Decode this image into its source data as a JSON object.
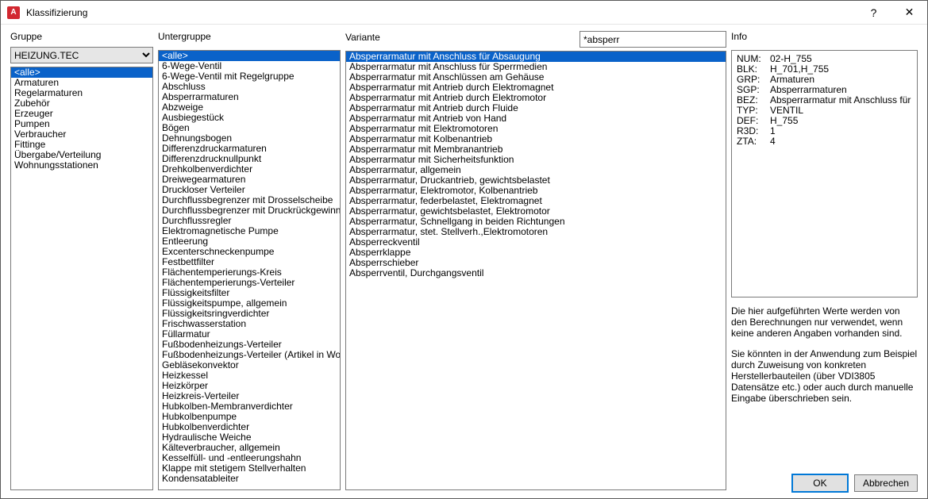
{
  "window": {
    "title": "Klassifizierung",
    "help_icon": "?",
    "close_icon": "✕"
  },
  "labels": {
    "gruppe": "Gruppe",
    "untergruppe": "Untergruppe",
    "variante": "Variante",
    "info": "Info"
  },
  "gruppe": {
    "selected_combo": "HEIZUNG.TEC",
    "items": [
      "<alle>",
      "Armaturen",
      "Regelarmaturen",
      "Zubehör",
      "Erzeuger",
      "Pumpen",
      "Verbraucher",
      "Fittinge",
      "Übergabe/Verteilung",
      "Wohnungsstationen"
    ],
    "selected_index": 0
  },
  "untergruppe": {
    "items": [
      "<alle>",
      "6-Wege-Ventil",
      "6-Wege-Ventil mit Regelgruppe",
      "Abschluss",
      "Absperrarmaturen",
      "Abzweige",
      "Ausbiegestück",
      "Bögen",
      "Dehnungsbogen",
      "Differenzdruckarmaturen",
      "Differenzdrucknullpunkt",
      "Drehkolbenverdichter",
      "Dreiwegearmaturen",
      "Druckloser Verteiler",
      "Durchflussbegrenzer mit Drosselscheibe",
      "Durchflussbegrenzer mit Druckrückgewinnung",
      "Durchflussregler",
      "Elektromagnetische Pumpe",
      "Entleerung",
      "Excenterschneckenpumpe",
      "Festbettfilter",
      "Flächentemperierungs-Kreis",
      "Flächentemperierungs-Verteiler",
      "Flüssigkeitsfilter",
      "Flüssigkeitspumpe, allgemein",
      "Flüssigkeitsringverdichter",
      "Frischwasserstation",
      "Füllarmatur",
      "Fußbodenheizungs-Verteiler",
      "Fußbodenheizungs-Verteiler (Artikel in Wohnung)",
      "Gebläsekonvektor",
      "Heizkessel",
      "Heizkörper",
      "Heizkreis-Verteiler",
      "Hubkolben-Membranverdichter",
      "Hubkolbenpumpe",
      "Hubkolbenverdichter",
      "Hydraulische Weiche",
      "Kälteverbraucher, allgemein",
      "Kesselfüll- und -entleerungshahn",
      "Klappe mit stetigem Stellverhalten",
      "Kondensatableiter"
    ],
    "selected_index": 0
  },
  "search": {
    "value": "*absperr"
  },
  "variante": {
    "items": [
      "Absperrarmatur mit Anschluss für Absaugung",
      "Absperrarmatur mit Anschluss für Sperrmedien",
      "Absperrarmatur mit Anschlüssen am Gehäuse",
      "Absperrarmatur mit Antrieb durch Elektromagnet",
      "Absperrarmatur mit Antrieb durch Elektromotor",
      "Absperrarmatur mit Antrieb durch Fluide",
      "Absperrarmatur mit Antrieb von Hand",
      "Absperrarmatur mit Elektromotoren",
      "Absperrarmatur mit Kolbenantrieb",
      "Absperrarmatur mit Membranantrieb",
      "Absperrarmatur mit Sicherheitsfunktion",
      "Absperrarmatur, allgemein",
      "Absperrarmatur, Druckantrieb, gewichtsbelastet",
      "Absperrarmatur, Elektromotor, Kolbenantrieb",
      "Absperrarmatur, federbelastet, Elektromagnet",
      "Absperrarmatur, gewichtsbelastet, Elektromotor",
      "Absperrarmatur, Schnellgang in beiden Richtungen",
      "Absperrarmatur, stet. Stellverh.,Elektromotoren",
      "Absperreckventil",
      "Absperrklappe",
      "Absperrschieber",
      "Absperrventil, Durchgangsventil"
    ],
    "selected_index": 0
  },
  "info": {
    "rows": [
      {
        "key": "NUM:",
        "val": "02-H_755"
      },
      {
        "key": "BLK:",
        "val": "H_701,H_755"
      },
      {
        "key": "GRP:",
        "val": "Armaturen"
      },
      {
        "key": "SGP:",
        "val": "Absperrarmaturen"
      },
      {
        "key": "BEZ:",
        "val": "Absperrarmatur mit Anschluss für Absaugung"
      },
      {
        "key": "TYP:",
        "val": "VENTIL"
      },
      {
        "key": "DEF:",
        "val": "H_755"
      },
      {
        "key": "R3D:",
        "val": "1"
      },
      {
        "key": "ZTA:",
        "val": "4"
      }
    ],
    "para1": "Die hier aufgeführten Werte werden von den Berechnungen nur verwendet, wenn keine anderen Angaben vorhanden sind.",
    "para2": "Sie könnten in der Anwendung zum Beispiel durch Zuweisung von konkreten Herstellerbauteilen (über VDI3805 Datensätze etc.) oder auch durch manuelle Eingabe überschrieben sein."
  },
  "buttons": {
    "ok": "OK",
    "cancel": "Abbrechen"
  }
}
